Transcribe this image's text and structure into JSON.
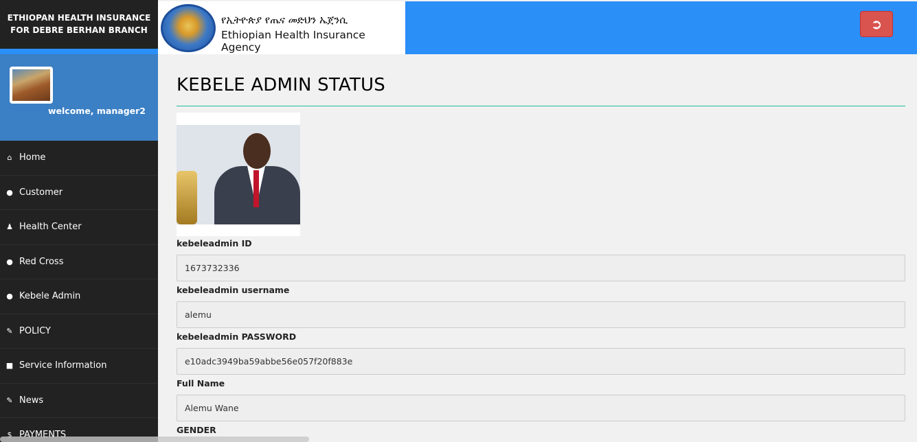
{
  "brand": {
    "line1": "ETHIOPAN HEALTH INSURANCE",
    "line2": "FOR DEBRE BERHAN BRANCH"
  },
  "profile": {
    "welcome": "welcome, manager2"
  },
  "sidebar": {
    "items": [
      {
        "label": "Home",
        "icon": "home-icon"
      },
      {
        "label": "Customer",
        "icon": "users-icon"
      },
      {
        "label": "Health Center",
        "icon": "user-md-icon"
      },
      {
        "label": "Red Cross",
        "icon": "users-icon"
      },
      {
        "label": "Kebele Admin",
        "icon": "users-icon"
      },
      {
        "label": "POLICY",
        "icon": "edit-icon"
      },
      {
        "label": "Service Information",
        "icon": "book-icon"
      },
      {
        "label": "News",
        "icon": "edit-icon"
      },
      {
        "label": "PAYMENTS",
        "icon": "dollar-icon"
      }
    ]
  },
  "header": {
    "logo_amharic": "የኢትዮጵያ የጤና መድህን ኤጀንሲ",
    "logo_english": "Ethiopian Health Insurance Agency",
    "accent_color": "#2a8ff7",
    "logout_color": "#d9534f"
  },
  "main": {
    "title": "KEBELE ADMIN STATUS",
    "fields": [
      {
        "label": "kebeleadmin ID",
        "value": "1673732336"
      },
      {
        "label": "kebeleadmin username",
        "value": "alemu"
      },
      {
        "label": "kebeleadmin PASSWORD",
        "value": "e10adc3949ba59abbe56e057f20f883e"
      },
      {
        "label": "Full Name",
        "value": "Alemu Wane"
      }
    ],
    "gender_label": "GENDER"
  }
}
